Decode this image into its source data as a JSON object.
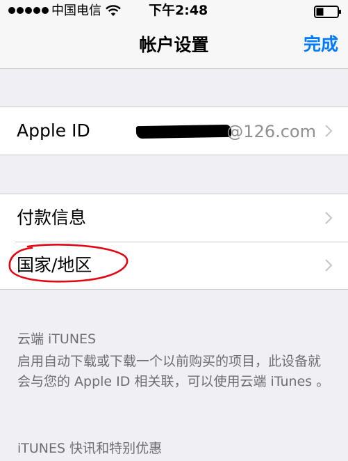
{
  "status_bar": {
    "carrier": "中国电信",
    "time": "下午2:48"
  },
  "nav": {
    "title": "帐户设置",
    "done_label": "完成"
  },
  "account_group": {
    "apple_id_label": "Apple ID",
    "apple_id_value": "@126.com"
  },
  "settings_group": {
    "items": [
      {
        "label": "付款信息"
      },
      {
        "label": "国家/地区"
      }
    ]
  },
  "itunes_cloud": {
    "header": "云端 iTUNES",
    "description": "启用自动下载或下载一个以前购买的项目，此设备就会与您的 Apple ID 相关联，可以使用云端 iTunes 。"
  },
  "itunes_news": {
    "header": "iTUNES 快讯和特别优惠"
  },
  "colors": {
    "accent": "#007aff",
    "background": "#efeff4",
    "annotation": "#e30613"
  }
}
